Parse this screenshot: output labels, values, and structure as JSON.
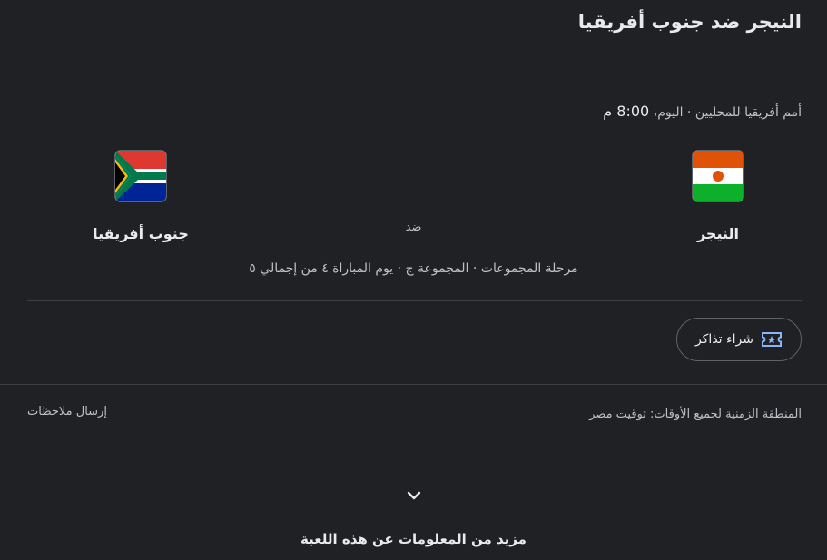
{
  "match": {
    "title": "النيجر ضد جنوب أفريقيا",
    "competition": "أمم أفريقيا للمحليين",
    "day": "اليوم،",
    "time": "8:00 م",
    "vs_label": "ضد",
    "stage": "مرحلة المجموعات · المجموعة ج · يوم المباراة ٤ من إجمالي ٥"
  },
  "teams": {
    "home": {
      "name": "النيجر",
      "flag_icon": "niger-flag-icon"
    },
    "away": {
      "name": "جنوب أفريقيا",
      "flag_icon": "south-africa-flag-icon"
    }
  },
  "tickets": {
    "label": "شراء تذاكر",
    "icon": "ticket-icon"
  },
  "footer": {
    "timezone": "المنطقة الزمنية لجميع الأوقات: توقيت مصر",
    "feedback": "إرسال ملاحظات",
    "more_info": "مزيد من المعلومات عن هذه اللعبة",
    "expand_icon": "chevron-down-icon"
  },
  "colors": {
    "background": "#202124",
    "text": "#e8eaed",
    "secondary_text": "#bdc1c6",
    "divider": "#3c4043",
    "ticket_icon_blue": "#8ab4f8"
  }
}
